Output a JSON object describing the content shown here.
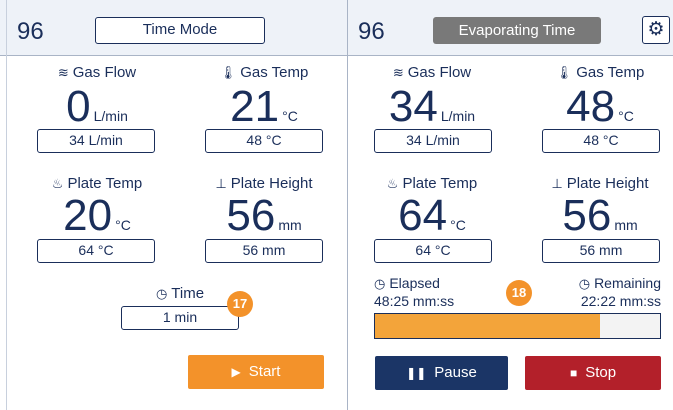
{
  "left": {
    "unit_id": "96",
    "mode_label": "Time Mode",
    "gas_flow": {
      "title": "Gas Flow",
      "icon": "gas-flow-icon",
      "value": "0",
      "unit": "L/min",
      "setpoint": "34 L/min"
    },
    "gas_temp": {
      "title": "Gas Temp",
      "icon": "thermometer-icon",
      "value": "21",
      "unit": "°C",
      "setpoint": "48 °C"
    },
    "plate_temp": {
      "title": "Plate Temp",
      "icon": "heat-icon",
      "value": "20",
      "unit": "°C",
      "setpoint": "64 °C"
    },
    "plate_height": {
      "title": "Plate Height",
      "icon": "height-icon",
      "value": "56",
      "unit": "mm",
      "setpoint": "56 mm"
    },
    "time": {
      "title": "Time",
      "icon": "clock-icon",
      "setpoint": "1 min"
    },
    "badge": "17",
    "start_label": "Start"
  },
  "right": {
    "unit_id": "96",
    "status_label": "Evaporating Time",
    "gas_flow": {
      "title": "Gas Flow",
      "icon": "gas-flow-icon",
      "value": "34",
      "unit": "L/min",
      "setpoint": "34 L/min"
    },
    "gas_temp": {
      "title": "Gas Temp",
      "icon": "thermometer-icon",
      "value": "48",
      "unit": "°C",
      "setpoint": "48 °C"
    },
    "plate_temp": {
      "title": "Plate Temp",
      "icon": "heat-icon",
      "value": "64",
      "unit": "°C",
      "setpoint": "64 °C"
    },
    "plate_height": {
      "title": "Plate Height",
      "icon": "height-icon",
      "value": "56",
      "unit": "mm",
      "setpoint": "56 mm"
    },
    "elapsed_label": "Elapsed",
    "elapsed_value": "48:25 mm:ss",
    "remaining_label": "Remaining",
    "remaining_value": "22:22 mm:ss",
    "badge": "18",
    "progress_fraction": 0.79,
    "pause_label": "Pause",
    "stop_label": "Stop"
  },
  "colors": {
    "accent_orange": "#f3922a",
    "navy": "#1a2e5a",
    "pause_blue": "#1b3566",
    "stop_red": "#b3202a",
    "status_grey": "#797979"
  }
}
